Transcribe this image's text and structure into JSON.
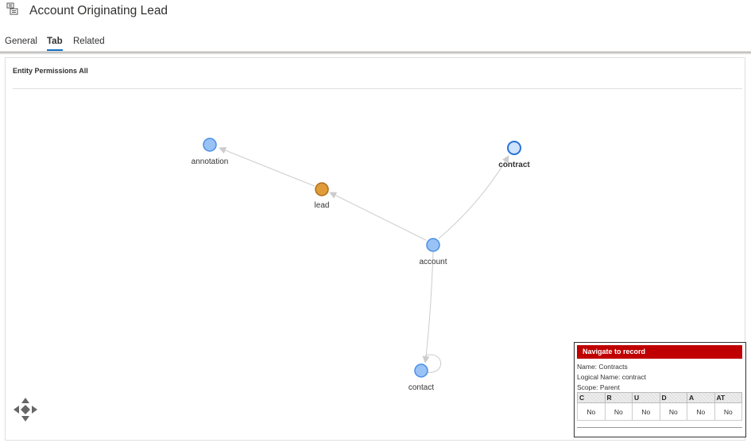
{
  "header": {
    "title": "Account Originating Lead",
    "record_icon": "record-icon"
  },
  "tabs": [
    {
      "label": "General",
      "active": false
    },
    {
      "label": "Tab",
      "active": true
    },
    {
      "label": "Related",
      "active": false
    }
  ],
  "section": {
    "title": "Entity Permissions All"
  },
  "graph": {
    "nodes": [
      {
        "id": "annotation",
        "label": "annotation",
        "color": "#99c2f5"
      },
      {
        "id": "lead",
        "label": "lead",
        "color": "#e09c38"
      },
      {
        "id": "contract",
        "label": "contract",
        "color": "#cde3fb",
        "selected": true
      },
      {
        "id": "account",
        "label": "account",
        "color": "#99c2f5"
      },
      {
        "id": "contact",
        "label": "contact",
        "color": "#99c2f5"
      }
    ],
    "edges": [
      {
        "from": "lead",
        "to": "annotation"
      },
      {
        "from": "account",
        "to": "lead"
      },
      {
        "from": "account",
        "to": "contract"
      },
      {
        "from": "account",
        "to": "contact"
      },
      {
        "from": "contact",
        "to": "contact"
      }
    ]
  },
  "popup": {
    "navigate_label": "Navigate to record",
    "name": "Name: Contracts",
    "logical_name": "Logical Name: contract",
    "scope": "Scope: Parent",
    "columns": [
      "C",
      "R",
      "U",
      "D",
      "A",
      "AT"
    ],
    "values": [
      "No",
      "No",
      "No",
      "No",
      "No",
      "No"
    ]
  },
  "colors": {
    "accent": "#0f6cbd",
    "navigate_bg": "#c00000",
    "edge": "#cccccc",
    "node_stroke": "#4a8ee6"
  },
  "navigation_control": {
    "icon": "pan-arrows-icon"
  }
}
